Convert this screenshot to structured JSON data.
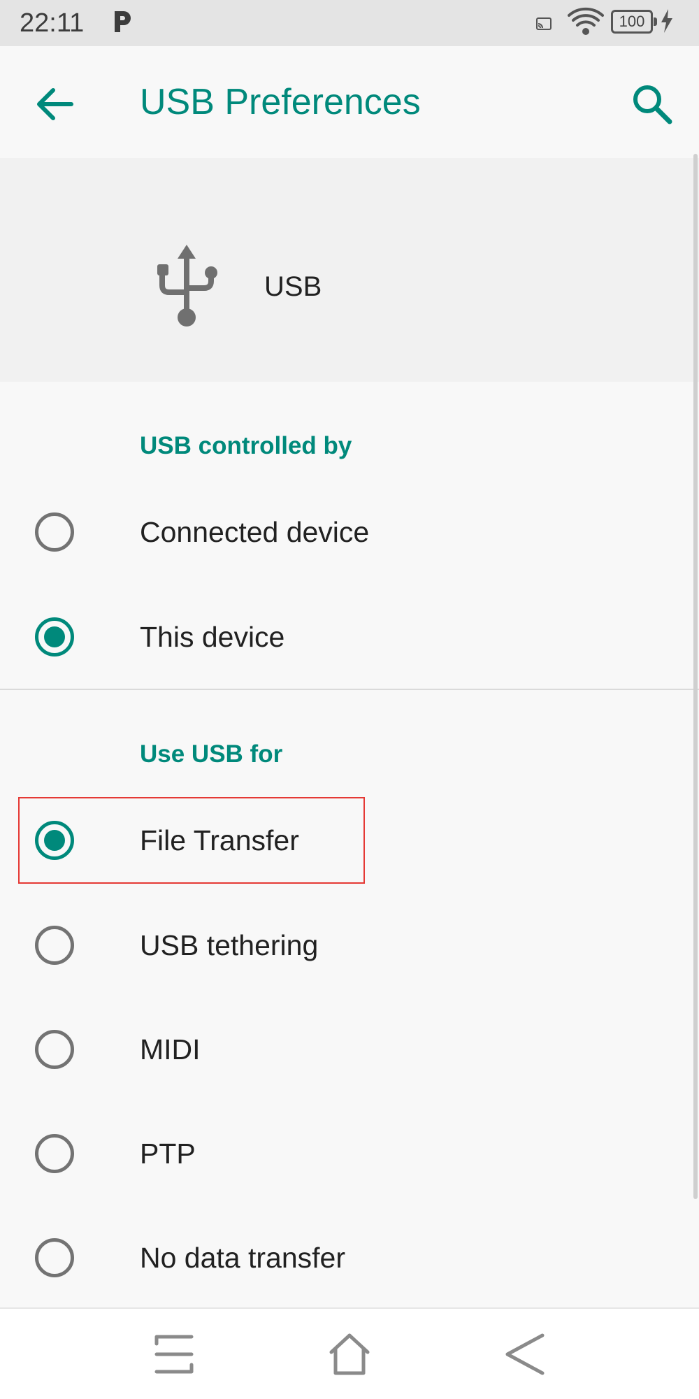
{
  "status_bar": {
    "time": "22:11",
    "battery": "100",
    "icons": [
      "p-notification-icon",
      "cast-icon",
      "wifi-icon",
      "battery-icon",
      "charging-bolt-icon"
    ]
  },
  "app_bar": {
    "title": "USB Preferences",
    "back_icon": "arrow-left-icon",
    "search_icon": "search-icon"
  },
  "header": {
    "icon": "usb-icon",
    "label": "USB"
  },
  "controlled_by": {
    "title": "USB controlled by",
    "options": [
      {
        "label": "Connected device",
        "selected": false
      },
      {
        "label": "This device",
        "selected": true
      }
    ]
  },
  "use_usb_for": {
    "title": "Use USB for",
    "options": [
      {
        "label": "File Transfer",
        "selected": true
      },
      {
        "label": "USB tethering",
        "selected": false
      },
      {
        "label": "MIDI",
        "selected": false
      },
      {
        "label": "PTP",
        "selected": false
      },
      {
        "label": "No data transfer",
        "selected": false
      }
    ]
  },
  "nav_bar": {
    "buttons": [
      "menu-icon",
      "home-icon",
      "back-chevron-icon"
    ]
  },
  "colors": {
    "accent": "#00897b",
    "highlight": "#e53935"
  }
}
